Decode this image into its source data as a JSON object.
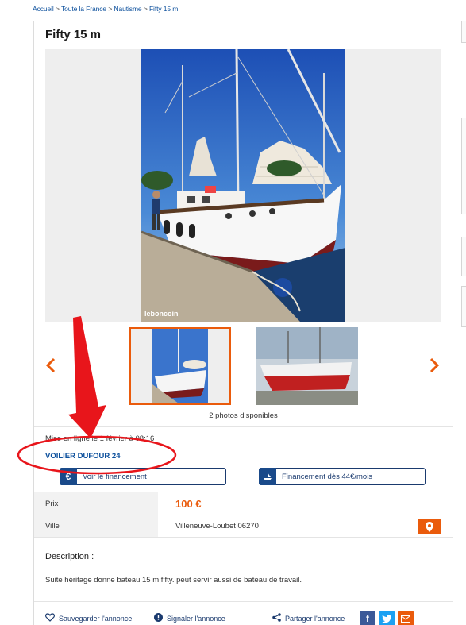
{
  "breadcrumb": {
    "items": [
      "Accueil",
      "Toute la France",
      "Nautisme",
      "Fifty 15 m"
    ],
    "separator": ">"
  },
  "ad": {
    "title": "Fifty 15 m",
    "watermark": "leboncoin",
    "photo_count": "2 photos disponibles",
    "posted": "Mise en ligne le 1 février à 08:16",
    "model": "VOILIER DUFOUR 24"
  },
  "financing": {
    "see_label": "Voir le financement",
    "from_label": "Financement dès 44€/mois"
  },
  "details": {
    "price_label": "Prix",
    "price_value": "100 €",
    "city_label": "Ville",
    "city_value": "Villeneuve-Loubet 06270"
  },
  "description": {
    "title": "Description :",
    "text": "Suite héritage donne bateau 15 m fifty. peut servir aussi de bateau de travail."
  },
  "actions": {
    "save": "Sauvegarder l'annonce",
    "report": "Signaler l'annonce",
    "share": "Partager l'annonce"
  },
  "icons": {
    "prev": "chevron-left-icon",
    "next": "chevron-right-icon",
    "map": "map-pin-icon",
    "heart": "heart-icon",
    "alert": "alert-icon",
    "share": "share-icon",
    "facebook": "facebook-icon",
    "twitter": "twitter-icon",
    "mail": "mail-icon"
  },
  "colors": {
    "accent": "#ea5b0c",
    "link": "#0b4f9c",
    "navy": "#1a3a6e",
    "annotation": "#e8151b"
  }
}
